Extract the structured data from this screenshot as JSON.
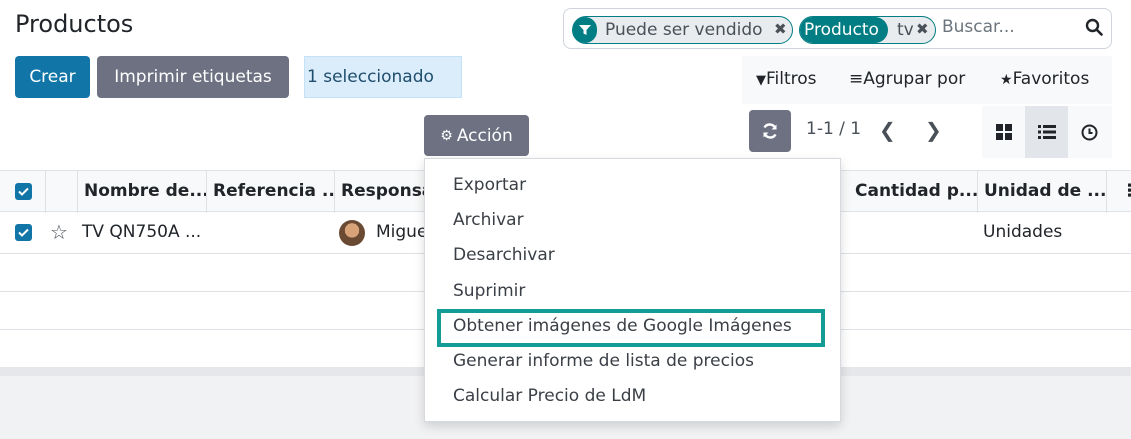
{
  "page": {
    "title": "Productos"
  },
  "search": {
    "facet1_label": "Puede ser vendido",
    "facet2_tag": "Producto",
    "facet2_value": "tv",
    "placeholder": "Buscar..."
  },
  "toolbar": {
    "create_label": "Crear",
    "print_labels_label": "Imprimir etiquetas",
    "selected_label": "1 seleccionado",
    "action_label": "Acción",
    "filters_label": "Filtros",
    "group_by_label": "Agrupar por",
    "favorites_label": "Favoritos"
  },
  "pager": {
    "value": "1-1 / 1"
  },
  "table": {
    "headers": [
      "Nombre de...",
      "Referencia ...",
      "Responsa",
      "Cantidad p...",
      "Unidad de ..."
    ],
    "rows": [
      {
        "name": "TV QN750A ...",
        "responsible": "Migue",
        "unit": "Unidades"
      }
    ]
  },
  "action_menu": {
    "items": [
      "Exportar",
      "Archivar",
      "Desarchivar",
      "Suprimir",
      "Obtener imágenes de Google Imágenes",
      "Generar informe de lista de precios",
      "Calcular Precio de LdM"
    ]
  },
  "colors": {
    "primary": "#1175a8",
    "secondary": "#6d7182",
    "facet": "#017e84",
    "highlight": "#139c95"
  }
}
